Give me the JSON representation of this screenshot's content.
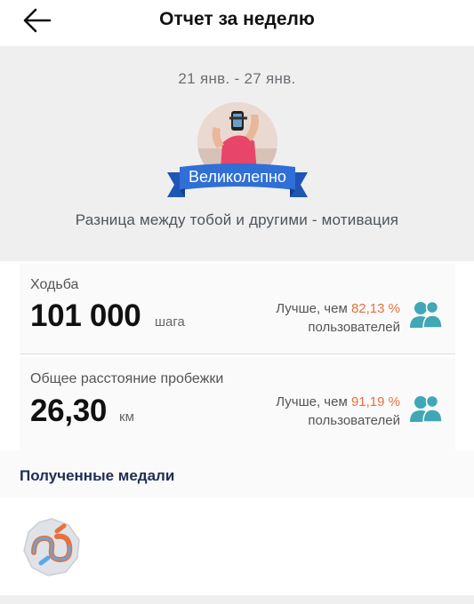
{
  "header": {
    "title": "Отчет за неделю",
    "back_icon": "arrow-left-icon"
  },
  "summary": {
    "date_range": "21 янв. - 27 янв.",
    "badge_label": "Великолепно",
    "motivation": "Разница между тобой и другими - мотивация",
    "ribbon_color": "#2f6fd6"
  },
  "stats": {
    "walking": {
      "label": "Ходьба",
      "value": "101 000",
      "unit": "шага",
      "compare_prefix": "Лучше, чем",
      "percent": "82,13 %",
      "compare_suffix": "пользователей"
    },
    "running": {
      "label": "Общее расстояние пробежки",
      "value": "26,30",
      "unit": "км",
      "compare_prefix": "Лучше, чем",
      "percent": "91,19 %",
      "compare_suffix": "пользователей"
    },
    "accent_color": "#e5713f",
    "icon_color": "#3fa7b5"
  },
  "medals": {
    "title": "Полученные медали",
    "items": [
      {
        "icon": "medal-icon"
      }
    ]
  }
}
